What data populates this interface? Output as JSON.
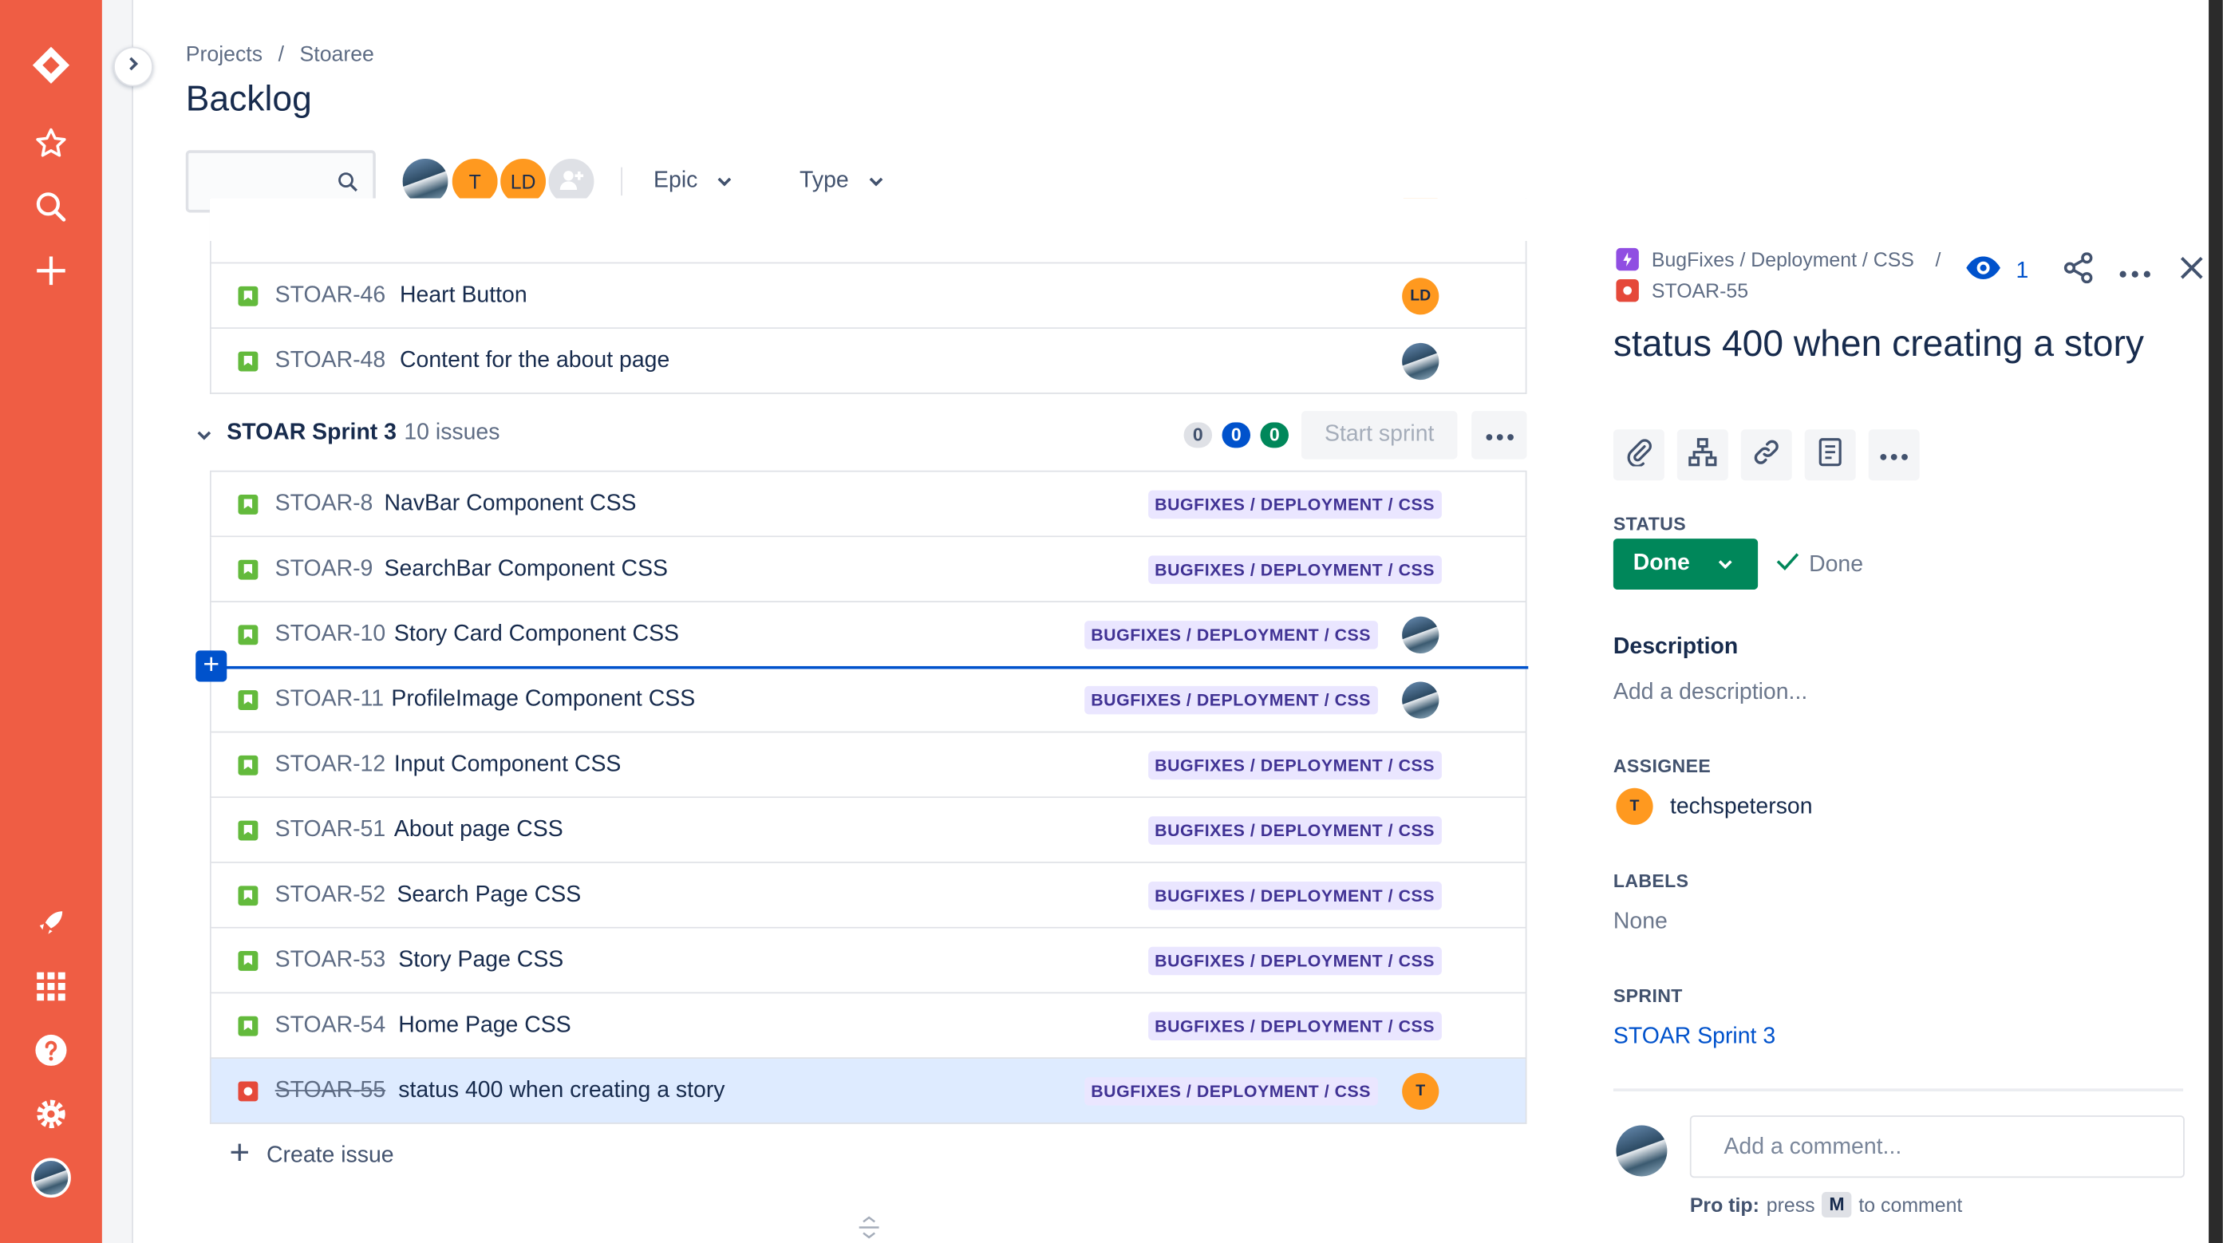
{
  "breadcrumb": {
    "projects": "Projects",
    "separator": "/",
    "project": "Stoaree"
  },
  "page_title": "Backlog",
  "search": {
    "placeholder": ""
  },
  "avatars": {
    "t": "T",
    "ld": "LD"
  },
  "filters": {
    "epic": "Epic",
    "type": "Type"
  },
  "top_rows": [
    {
      "key": "STOAR-46",
      "summary": "Heart Button",
      "assignee": "LD"
    },
    {
      "key": "STOAR-48",
      "summary": "Content for the about page",
      "assignee": ""
    }
  ],
  "sprint": {
    "name": "STOAR Sprint 3",
    "count": "10 issues",
    "pills": [
      "0",
      "0",
      "0"
    ],
    "start_label": "Start sprint"
  },
  "epic_label": "BUGFIXES / DEPLOYMENT / CSS",
  "sprint_rows": [
    {
      "key": "STOAR-8",
      "summary": "NavBar Component CSS",
      "type": "story",
      "assignee": ""
    },
    {
      "key": "STOAR-9",
      "summary": "SearchBar Component CSS",
      "type": "story",
      "assignee": ""
    },
    {
      "key": "STOAR-10",
      "summary": "Story Card Component CSS",
      "type": "story",
      "assignee": "avatar"
    },
    {
      "key": "STOAR-11",
      "summary": "ProfileImage Component CSS",
      "type": "story",
      "assignee": "avatar"
    },
    {
      "key": "STOAR-12",
      "summary": "Input Component CSS",
      "type": "story",
      "assignee": ""
    },
    {
      "key": "STOAR-51",
      "summary": "About page CSS",
      "type": "story",
      "assignee": ""
    },
    {
      "key": "STOAR-52",
      "summary": "Search Page CSS",
      "type": "story",
      "assignee": ""
    },
    {
      "key": "STOAR-53",
      "summary": "Story Page CSS",
      "type": "story",
      "assignee": ""
    },
    {
      "key": "STOAR-54",
      "summary": "Home Page CSS",
      "type": "story",
      "assignee": ""
    },
    {
      "key": "STOAR-55",
      "summary": "status 400 when creating a story",
      "type": "bug",
      "assignee": "T"
    }
  ],
  "create_issue": "Create issue",
  "detail": {
    "epic_crumb": "BugFixes / Deployment / CSS",
    "crumb_sep": "/",
    "issue_key": "STOAR-55",
    "watchers": "1",
    "title": "status 400 when creating a story",
    "status_label": "STATUS",
    "status_value": "Done",
    "status_resolution": "Done",
    "description_label": "Description",
    "description_placeholder": "Add a description...",
    "assignee_label": "ASSIGNEE",
    "assignee_initial": "T",
    "assignee_name": "techspeterson",
    "labels_label": "LABELS",
    "labels_value": "None",
    "sprint_label": "SPRINT",
    "sprint_value": "STOAR Sprint 3",
    "comment_placeholder": "Add a comment...",
    "protip_bold": "Pro tip:",
    "protip_press": "press",
    "protip_key": "M",
    "protip_rest": "to comment"
  },
  "colors": {
    "nav": "#ef5d44",
    "done": "#00875a",
    "link": "#0052cc",
    "epic_bg": "#eae6ff",
    "epic_text": "#403294"
  }
}
